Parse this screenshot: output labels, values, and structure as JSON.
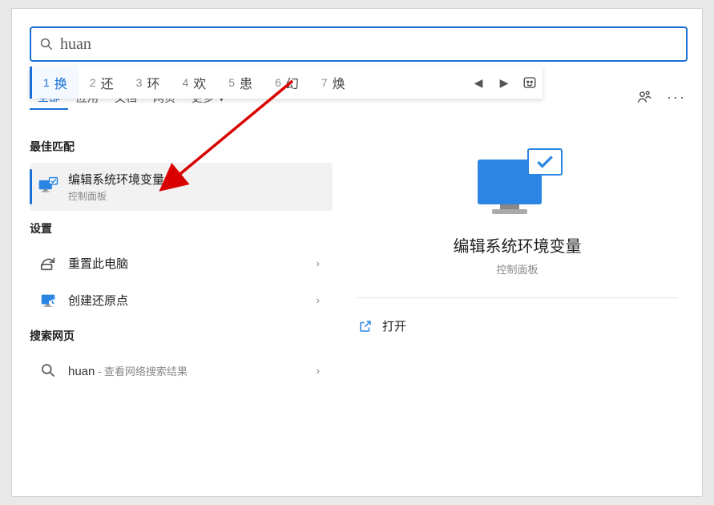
{
  "search": {
    "query": "huan"
  },
  "ime": {
    "candidates": [
      {
        "n": "1",
        "ch": "换",
        "selected": true
      },
      {
        "n": "2",
        "ch": "还"
      },
      {
        "n": "3",
        "ch": "环"
      },
      {
        "n": "4",
        "ch": "欢"
      },
      {
        "n": "5",
        "ch": "患"
      },
      {
        "n": "6",
        "ch": "幻"
      },
      {
        "n": "7",
        "ch": "焕"
      }
    ]
  },
  "tabs": {
    "items": [
      "全部",
      "应用",
      "文档",
      "网页"
    ],
    "more": "更多",
    "active_index": 0
  },
  "sections": {
    "best_match": "最佳匹配",
    "settings": "设置",
    "search_web": "搜索网页"
  },
  "results": {
    "best": {
      "title": "编辑系统环境变量",
      "subtitle": "控制面板"
    },
    "settings": [
      {
        "title": "重置此电脑"
      },
      {
        "title": "创建还原点"
      }
    ],
    "web": {
      "query": "huan",
      "suffix": " - 查看网络搜索结果"
    }
  },
  "preview": {
    "title": "编辑系统环境变量",
    "subtitle": "控制面板",
    "actions": {
      "open": "打开"
    }
  },
  "colors": {
    "accent": "#1a6fd6",
    "arrow": "#d80000"
  }
}
